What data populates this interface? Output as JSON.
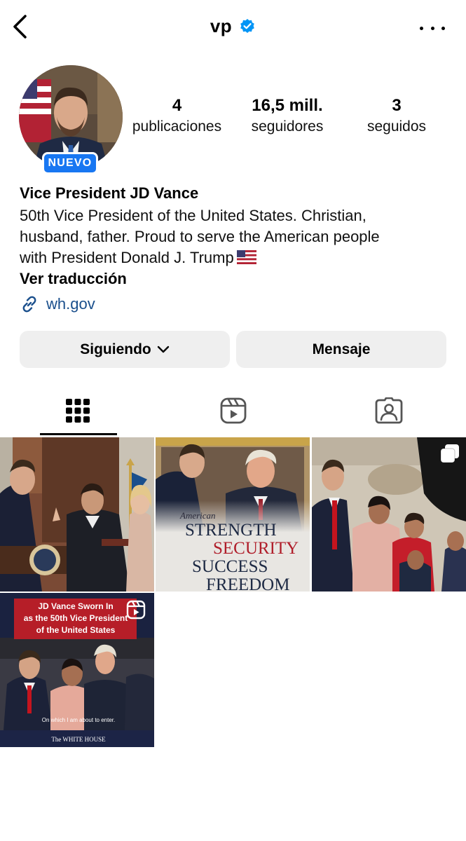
{
  "header": {
    "username": "vp",
    "verified": true,
    "accent_color": "#1877f2"
  },
  "profile": {
    "avatar_badge": "NUEVO",
    "stats": [
      {
        "number": "4",
        "label": "publicaciones"
      },
      {
        "number": "16,5 mill.",
        "label": "seguidores"
      },
      {
        "number": "3",
        "label": "seguidos"
      }
    ],
    "full_name": "Vice President JD Vance",
    "bio_lines": [
      "50th Vice President of the United States. Christian,",
      "husband, father. Proud to serve the American people",
      "with President Donald J. Trump"
    ],
    "flag_icon": "us-flag-emoji",
    "translate_label": "Ver traducción",
    "link": "wh.gov",
    "link_color": "#1a4f8c"
  },
  "actions": {
    "following_label": "Siguiendo",
    "message_label": "Mensaje"
  },
  "tabs": [
    {
      "name": "posts-grid",
      "icon": "grid-icon",
      "active": true
    },
    {
      "name": "reels",
      "icon": "reels-icon",
      "active": false
    },
    {
      "name": "tagged",
      "icon": "tagged-person-icon",
      "active": false
    }
  ],
  "posts": [
    {
      "kind": "photo",
      "icon": "none"
    },
    {
      "kind": "graphic",
      "text_lines": [
        "American",
        "STRENGTH",
        "SECURITY",
        "SUCCESS",
        "FREEDOM"
      ],
      "icon": "none"
    },
    {
      "kind": "carousel",
      "icon": "carousel-icon"
    },
    {
      "kind": "reel",
      "icon": "reels-icon",
      "headline_lines": [
        "JD Vance Sworn In",
        "as the 50th Vice President",
        "of the United States"
      ],
      "caption": "On which I am about to enter.",
      "footer": "The WHITE HOUSE"
    }
  ]
}
